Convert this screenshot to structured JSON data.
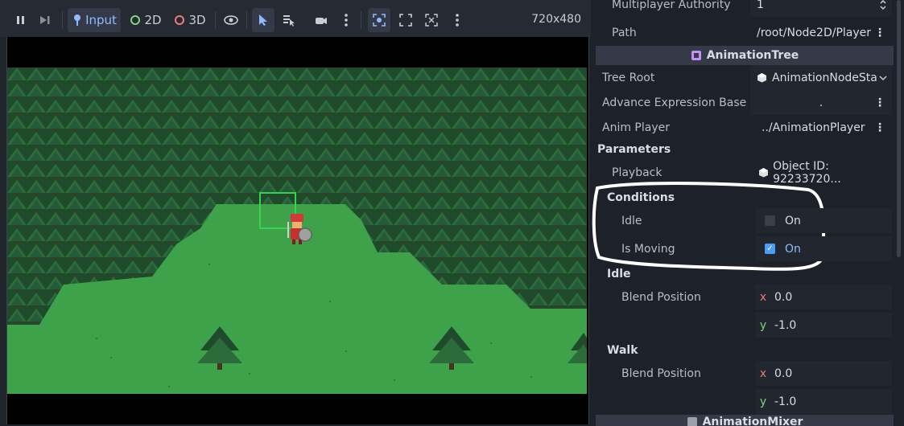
{
  "toolbar": {
    "input_label": "Input",
    "two_d_label": "2D",
    "three_d_label": "3D",
    "resolution": "720x480",
    "accent_blue": "#8fbcff",
    "two_d_color": "#7ed67e",
    "three_d_color": "#f07a7a"
  },
  "inspector": {
    "multiplayer": {
      "label": "Multiplayer Authority",
      "value": "1"
    },
    "path": {
      "label": "Path",
      "value": "/root/Node2D/Player"
    },
    "animation_tree_header": "AnimationTree",
    "tree_root": {
      "label": "Tree Root",
      "value": "AnimationNodeSta"
    },
    "advance_expression": {
      "label": "Advance Expression Base",
      "value": "."
    },
    "anim_player": {
      "label": "Anim Player",
      "value": "../AnimationPlayer"
    },
    "parameters_header": "Parameters",
    "playback": {
      "label": "Playback",
      "value": "Object ID: 92233720..."
    },
    "conditions_header": "Conditions",
    "idle_condition": {
      "label": "Idle",
      "value": "On",
      "checked": false
    },
    "is_moving_condition": {
      "label": "Is Moving",
      "value": "On",
      "checked": true
    },
    "idle_section": "Idle",
    "idle_blend": {
      "label": "Blend Position",
      "x_axis": "x",
      "x": "0.0",
      "y_axis": "y",
      "y": "-1.0"
    },
    "walk_section": "Walk",
    "walk_blend": {
      "label": "Blend Position",
      "x_axis": "x",
      "x": "0.0",
      "y_axis": "y",
      "y": "-1.0"
    },
    "mixer_header": "AnimationMixer"
  }
}
